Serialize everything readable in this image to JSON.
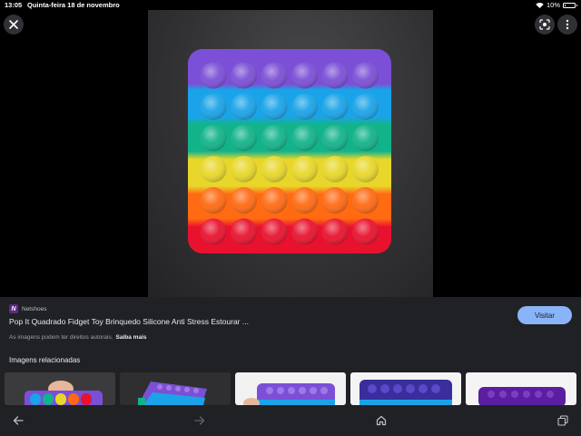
{
  "status_bar": {
    "time": "13:05",
    "date": "Quinta-feira 18 de novembro",
    "battery_text": "10%",
    "battery_level": 0.1
  },
  "viewer": {
    "close_icon": "close-icon",
    "lens_icon": "lens-icon",
    "more_icon": "more-vert-icon"
  },
  "result": {
    "source_logo": "N",
    "source_name": "Netshoes",
    "title": "Pop It Quadrado Fidget Toy Brinquedo Silicone Anti Stress Estourar ...",
    "visit_label": "Visitar",
    "copyright_text": "As imagens podem ter direitos autorais.",
    "learn_more": "Saiba mais"
  },
  "related": {
    "title": "Imagens relacionadas"
  },
  "nav": {
    "back_icon": "arrow-back-icon",
    "forward_icon": "arrow-forward-icon",
    "home_icon": "home-icon",
    "tabs_icon": "tabs-icon"
  },
  "colors": {
    "panel_bg": "#202124",
    "accent": "#8ab4f8",
    "rows": [
      "#7b4fd6",
      "#1aa3e8",
      "#12b38a",
      "#e8d72a",
      "#ff6a12",
      "#e8122e"
    ]
  }
}
